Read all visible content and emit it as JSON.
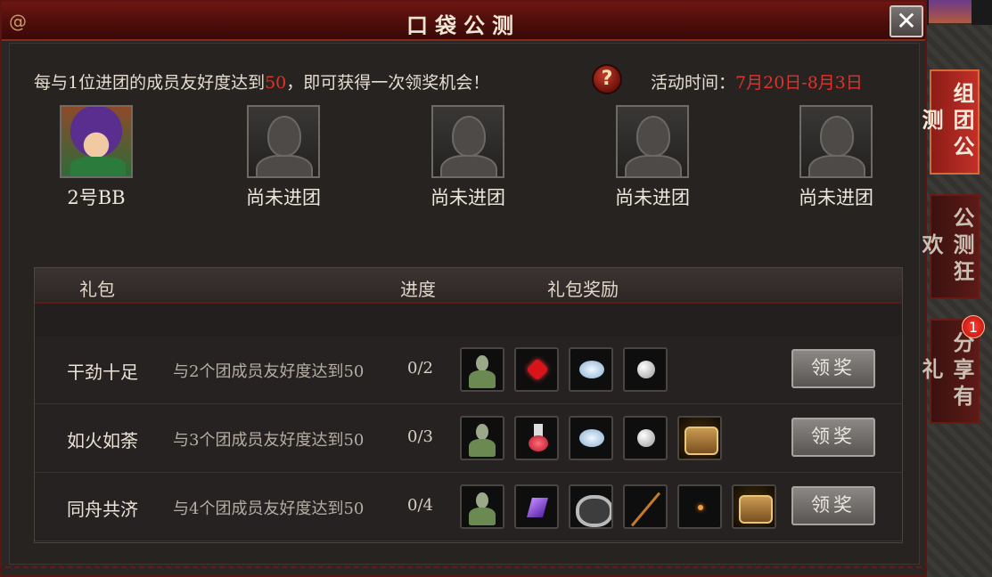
{
  "window": {
    "title": "口袋公测"
  },
  "intro": {
    "text_prefix": "每与1位进团的成员友好度达到",
    "threshold": "50",
    "text_suffix": "，即可获得一次领奖机会！"
  },
  "activity": {
    "label": "活动时间：",
    "value": "7月20日-8月3日"
  },
  "members": [
    {
      "name": "2号BB",
      "joined": true
    },
    {
      "name": "尚未进团",
      "joined": false
    },
    {
      "name": "尚未进团",
      "joined": false
    },
    {
      "name": "尚未进团",
      "joined": false
    },
    {
      "name": "尚未进团",
      "joined": false
    }
  ],
  "table": {
    "headers": {
      "pack": "礼包",
      "progress": "进度",
      "rewards": "礼包奖励"
    },
    "rows": [
      {
        "name": "干劲十足",
        "condition": "与2个团成员友好度达到50",
        "progress": "0/2",
        "claim": "领奖",
        "items": [
          "statue",
          "ruby",
          "crystal",
          "pearl"
        ]
      },
      {
        "name": "如火如荼",
        "condition": "与3个团成员友好度达到50",
        "progress": "0/3",
        "claim": "领奖",
        "items": [
          "statue",
          "potion",
          "crystal",
          "pearl",
          "chest"
        ]
      },
      {
        "name": "同舟共济",
        "condition": "与4个团成员友好度达到50",
        "progress": "0/4",
        "claim": "领奖",
        "items": [
          "statue",
          "gem",
          "ring",
          "rod",
          "spark",
          "chest"
        ]
      }
    ]
  },
  "side_tabs": [
    {
      "label": "组团公测",
      "active": true
    },
    {
      "label": "公测狂欢",
      "active": false
    },
    {
      "label": "分享有礼",
      "active": false,
      "badge": "1"
    }
  ],
  "colors": {
    "accent_red": "#e0332c",
    "frame_red": "#5a1512"
  },
  "icons": {
    "close": "close-icon",
    "help": "help-icon",
    "swirl": "swirl-ornament-icon"
  }
}
